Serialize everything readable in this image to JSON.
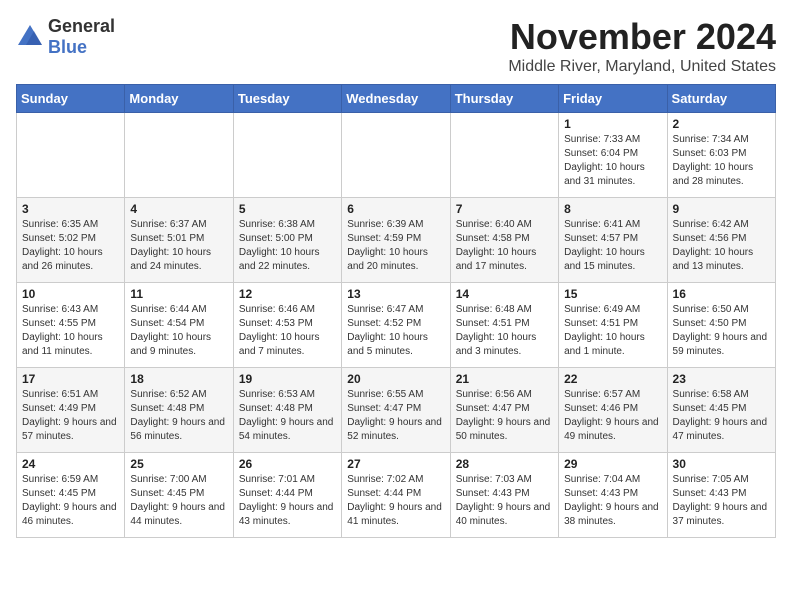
{
  "header": {
    "logo_general": "General",
    "logo_blue": "Blue",
    "title": "November 2024",
    "location": "Middle River, Maryland, United States"
  },
  "days_of_week": [
    "Sunday",
    "Monday",
    "Tuesday",
    "Wednesday",
    "Thursday",
    "Friday",
    "Saturday"
  ],
  "weeks": [
    [
      {
        "day": "",
        "info": ""
      },
      {
        "day": "",
        "info": ""
      },
      {
        "day": "",
        "info": ""
      },
      {
        "day": "",
        "info": ""
      },
      {
        "day": "",
        "info": ""
      },
      {
        "day": "1",
        "info": "Sunrise: 7:33 AM\nSunset: 6:04 PM\nDaylight: 10 hours and 31 minutes."
      },
      {
        "day": "2",
        "info": "Sunrise: 7:34 AM\nSunset: 6:03 PM\nDaylight: 10 hours and 28 minutes."
      }
    ],
    [
      {
        "day": "3",
        "info": "Sunrise: 6:35 AM\nSunset: 5:02 PM\nDaylight: 10 hours and 26 minutes."
      },
      {
        "day": "4",
        "info": "Sunrise: 6:37 AM\nSunset: 5:01 PM\nDaylight: 10 hours and 24 minutes."
      },
      {
        "day": "5",
        "info": "Sunrise: 6:38 AM\nSunset: 5:00 PM\nDaylight: 10 hours and 22 minutes."
      },
      {
        "day": "6",
        "info": "Sunrise: 6:39 AM\nSunset: 4:59 PM\nDaylight: 10 hours and 20 minutes."
      },
      {
        "day": "7",
        "info": "Sunrise: 6:40 AM\nSunset: 4:58 PM\nDaylight: 10 hours and 17 minutes."
      },
      {
        "day": "8",
        "info": "Sunrise: 6:41 AM\nSunset: 4:57 PM\nDaylight: 10 hours and 15 minutes."
      },
      {
        "day": "9",
        "info": "Sunrise: 6:42 AM\nSunset: 4:56 PM\nDaylight: 10 hours and 13 minutes."
      }
    ],
    [
      {
        "day": "10",
        "info": "Sunrise: 6:43 AM\nSunset: 4:55 PM\nDaylight: 10 hours and 11 minutes."
      },
      {
        "day": "11",
        "info": "Sunrise: 6:44 AM\nSunset: 4:54 PM\nDaylight: 10 hours and 9 minutes."
      },
      {
        "day": "12",
        "info": "Sunrise: 6:46 AM\nSunset: 4:53 PM\nDaylight: 10 hours and 7 minutes."
      },
      {
        "day": "13",
        "info": "Sunrise: 6:47 AM\nSunset: 4:52 PM\nDaylight: 10 hours and 5 minutes."
      },
      {
        "day": "14",
        "info": "Sunrise: 6:48 AM\nSunset: 4:51 PM\nDaylight: 10 hours and 3 minutes."
      },
      {
        "day": "15",
        "info": "Sunrise: 6:49 AM\nSunset: 4:51 PM\nDaylight: 10 hours and 1 minute."
      },
      {
        "day": "16",
        "info": "Sunrise: 6:50 AM\nSunset: 4:50 PM\nDaylight: 9 hours and 59 minutes."
      }
    ],
    [
      {
        "day": "17",
        "info": "Sunrise: 6:51 AM\nSunset: 4:49 PM\nDaylight: 9 hours and 57 minutes."
      },
      {
        "day": "18",
        "info": "Sunrise: 6:52 AM\nSunset: 4:48 PM\nDaylight: 9 hours and 56 minutes."
      },
      {
        "day": "19",
        "info": "Sunrise: 6:53 AM\nSunset: 4:48 PM\nDaylight: 9 hours and 54 minutes."
      },
      {
        "day": "20",
        "info": "Sunrise: 6:55 AM\nSunset: 4:47 PM\nDaylight: 9 hours and 52 minutes."
      },
      {
        "day": "21",
        "info": "Sunrise: 6:56 AM\nSunset: 4:47 PM\nDaylight: 9 hours and 50 minutes."
      },
      {
        "day": "22",
        "info": "Sunrise: 6:57 AM\nSunset: 4:46 PM\nDaylight: 9 hours and 49 minutes."
      },
      {
        "day": "23",
        "info": "Sunrise: 6:58 AM\nSunset: 4:45 PM\nDaylight: 9 hours and 47 minutes."
      }
    ],
    [
      {
        "day": "24",
        "info": "Sunrise: 6:59 AM\nSunset: 4:45 PM\nDaylight: 9 hours and 46 minutes."
      },
      {
        "day": "25",
        "info": "Sunrise: 7:00 AM\nSunset: 4:45 PM\nDaylight: 9 hours and 44 minutes."
      },
      {
        "day": "26",
        "info": "Sunrise: 7:01 AM\nSunset: 4:44 PM\nDaylight: 9 hours and 43 minutes."
      },
      {
        "day": "27",
        "info": "Sunrise: 7:02 AM\nSunset: 4:44 PM\nDaylight: 9 hours and 41 minutes."
      },
      {
        "day": "28",
        "info": "Sunrise: 7:03 AM\nSunset: 4:43 PM\nDaylight: 9 hours and 40 minutes."
      },
      {
        "day": "29",
        "info": "Sunrise: 7:04 AM\nSunset: 4:43 PM\nDaylight: 9 hours and 38 minutes."
      },
      {
        "day": "30",
        "info": "Sunrise: 7:05 AM\nSunset: 4:43 PM\nDaylight: 9 hours and 37 minutes."
      }
    ]
  ]
}
